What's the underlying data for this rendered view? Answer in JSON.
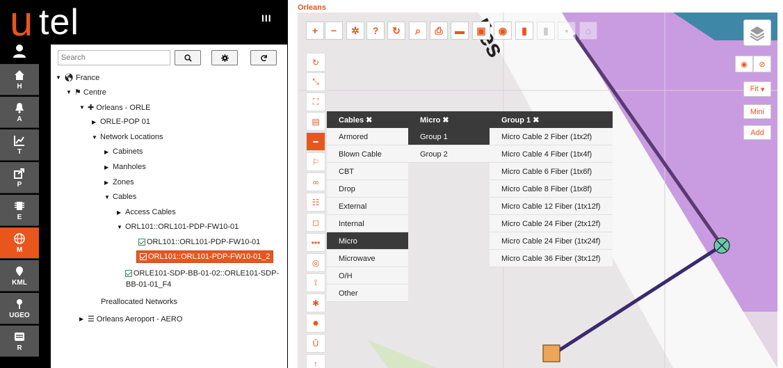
{
  "app": {
    "logo_u": "u",
    "logo_tel": "tel",
    "columns_icon": "III"
  },
  "nav": [
    {
      "label": "H",
      "icon": "home-icon"
    },
    {
      "label": "A",
      "icon": "bell-icon"
    },
    {
      "label": "T",
      "icon": "chart-icon"
    },
    {
      "label": "P",
      "icon": "share-icon"
    },
    {
      "label": "E",
      "icon": "chip-icon"
    },
    {
      "label": "M",
      "icon": "globe-icon",
      "active": true
    },
    {
      "label": "KML",
      "icon": "pin-icon"
    },
    {
      "label": "UGEO",
      "icon": "marker-icon"
    },
    {
      "label": "R",
      "icon": "list-icon"
    }
  ],
  "tree": {
    "search_placeholder": "Search",
    "nodes": [
      {
        "label": "France"
      },
      {
        "label": "Centre"
      },
      {
        "label": "Orleans - ORLE"
      },
      {
        "label": "ORLE-POP 01"
      },
      {
        "label": "Network Locations"
      },
      {
        "label": "Cabinets"
      },
      {
        "label": "Manholes"
      },
      {
        "label": "Zones"
      },
      {
        "label": "Cables"
      },
      {
        "label": "Access Cables"
      },
      {
        "label": "ORL101::ORL101-PDP-FW10-01"
      },
      {
        "label": "ORL101::ORL101-PDP-FW10-01"
      },
      {
        "label": "ORL101::ORL101-PDP-FW10-01_2"
      },
      {
        "label": "ORLE101-SDP-BB-01-02::ORLE101-SDP-"
      },
      {
        "label": "BB-01-01_F4"
      },
      {
        "label": "Preallocated Networks"
      },
      {
        "label": "Orleans Aeroport - AERO"
      }
    ]
  },
  "map": {
    "title": "Orleans",
    "fit_label": "Fit",
    "mini_label": "Mini",
    "add_label": "Add"
  },
  "menus": {
    "cables": {
      "header": "Cables",
      "items": [
        "Armored",
        "Blown Cable",
        "CBT",
        "Drop",
        "External",
        "Internal",
        "Micro",
        "Microwave",
        "O/H",
        "Other"
      ]
    },
    "micro": {
      "header": "Micro",
      "items": [
        "Group 1",
        "Group 2"
      ]
    },
    "group1": {
      "header": "Group 1",
      "items": [
        "Micro Cable 2 Fiber (1tx2f)",
        "Micro Cable 4 Fiber (1tx4f)",
        "Micro Cable 6 Fiber (1tx6f)",
        "Micro Cable 8 Fiber (1tx8f)",
        "Micro Cable 12 Fiber (1tx12f)",
        "Micro Cable 24 Fiber (2tx12f)",
        "Micro Cable 24 Fiber (1tx24f)",
        "Micro Cable 36 Fiber (3tx12f)"
      ]
    }
  },
  "colors": {
    "accent": "#e8561e",
    "menu_dark": "#3a3a3a",
    "map_purple": "#c79be0",
    "cable_dark": "#3d2a6a"
  }
}
